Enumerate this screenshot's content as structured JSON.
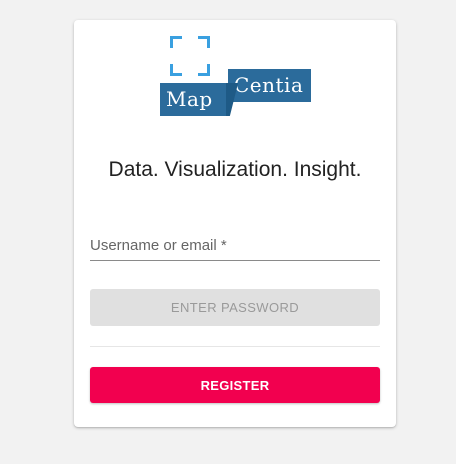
{
  "logo": {
    "word1": "Map",
    "word2": "Centia",
    "frame_color": "#3aa0e0",
    "block_color": "#2b6b9b"
  },
  "tagline": "Data. Visualization. Insight.",
  "form": {
    "username_label": "Username or email *",
    "username_value": "",
    "password_button": "ENTER PASSWORD",
    "register_button": "REGISTER"
  },
  "colors": {
    "register_bg": "#f2004f",
    "password_bg": "#e0e0e0",
    "page_bg": "#f2f2f2"
  }
}
